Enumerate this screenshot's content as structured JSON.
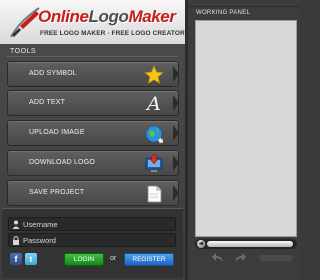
{
  "header": {
    "logo_word_1": "Online",
    "logo_word_2": "Logo",
    "logo_word_3": "Maker",
    "tagline_1": "FREE LOGO MAKER",
    "tagline_sep": " - ",
    "tagline_2": "FREE LOGO CREATOR"
  },
  "tools": {
    "heading": "TOOLS",
    "items": [
      {
        "label": "ADD SYMBOL",
        "icon": "star-icon"
      },
      {
        "label": "ADD TEXT",
        "icon": "text-italic-a-icon",
        "glyph": "A"
      },
      {
        "label": "UPLOAD IMAGE",
        "icon": "globe-upload-icon"
      },
      {
        "label": "DOWNLOAD LOGO",
        "icon": "monitor-download-icon"
      },
      {
        "label": "SAVE PROJECT",
        "icon": "document-icon"
      }
    ]
  },
  "login": {
    "username_placeholder": "Username",
    "password_placeholder": "Password",
    "social_facebook": "f",
    "social_twitter": "t",
    "login_label": "LOGIN",
    "or_label": "or",
    "register_label": "REGISTER"
  },
  "working_panel": {
    "title": "WORKING PANEL",
    "canvas_color": "#d8d8d8",
    "scroll_left_glyph": "◀"
  },
  "colors": {
    "brand_red": "#c41e1e",
    "login_green": "#15861a",
    "register_blue": "#1d66c0"
  }
}
